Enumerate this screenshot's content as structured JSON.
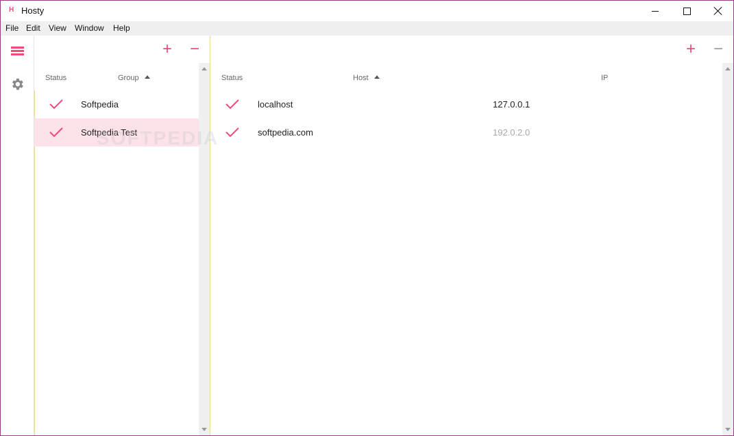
{
  "window": {
    "title": "Hosty",
    "app_icon_glyph": "H",
    "accent_color": "#ef4a7a",
    "border_color": "#9b3d86"
  },
  "menu": [
    "File",
    "Edit",
    "View",
    "Window",
    "Help"
  ],
  "sidebar": {
    "items": [
      {
        "icon": "list-icon",
        "active": true
      },
      {
        "icon": "gear-icon",
        "active": false
      }
    ]
  },
  "groups": {
    "add_label": "+",
    "remove_label": "−",
    "columns": {
      "status": "Status",
      "group": "Group"
    },
    "rows": [
      {
        "enabled": true,
        "name": "Softpedia",
        "selected": false
      },
      {
        "enabled": true,
        "name": "Softpedia Test",
        "selected": true
      }
    ]
  },
  "hosts": {
    "add_label": "+",
    "remove_label": "−",
    "columns": {
      "status": "Status",
      "host": "Host",
      "ip": "IP"
    },
    "rows": [
      {
        "enabled": true,
        "host": "localhost",
        "ip": "127.0.0.1",
        "ip_dim": false
      },
      {
        "enabled": true,
        "host": "softpedia.com",
        "ip": "192.0.2.0",
        "ip_dim": true
      }
    ]
  },
  "watermark": "SOFTPEDIA"
}
